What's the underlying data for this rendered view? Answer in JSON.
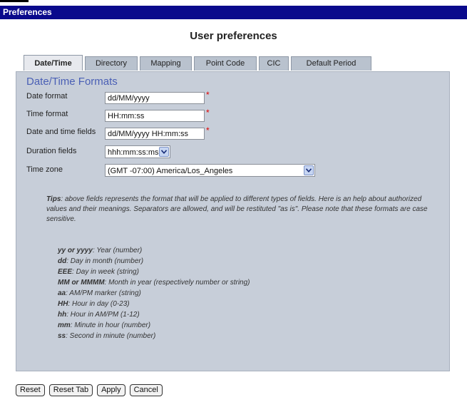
{
  "window": {
    "title": "Preferences"
  },
  "page": {
    "heading": "User preferences"
  },
  "tabs": [
    {
      "label": "Date/Time",
      "active": true
    },
    {
      "label": "Directory"
    },
    {
      "label": "Mapping"
    },
    {
      "label": "Point Code"
    },
    {
      "label": "CIC"
    },
    {
      "label": "Default Period"
    }
  ],
  "section": {
    "title": "Date/Time Formats"
  },
  "fields": {
    "date_format": {
      "label": "Date format",
      "value": "dd/MM/yyyy",
      "required": "*"
    },
    "time_format": {
      "label": "Time format",
      "value": "HH:mm:ss",
      "required": "*"
    },
    "datetime_fields": {
      "label": "Date and time fields",
      "value": "dd/MM/yyyy HH:mm:ss",
      "required": "*"
    },
    "duration_fields": {
      "label": "Duration fields",
      "value": "hhh:mm:ss:ms"
    },
    "time_zone": {
      "label": "Time zone",
      "value": "(GMT -07:00) America/Los_Angeles"
    }
  },
  "tips": {
    "lead": "Tips",
    "text": ": above fields represents the format that will be applied to different types of fields. Here is an help about authorized values and their meanings. Separators are allowed, and will be restituted \"as is\". Please note that these formats are case sensitive."
  },
  "legend": [
    {
      "key": "yy or yyyy",
      "desc": ": Year (number)"
    },
    {
      "key": "dd",
      "desc": ": Day in month (number)"
    },
    {
      "key": "EEE",
      "desc": ": Day in week (string)"
    },
    {
      "key": "MM or MMMM",
      "desc": ": Month in year (respectively number or string)"
    },
    {
      "key": "aa",
      "desc": ": AM/PM marker (string)"
    },
    {
      "key": "HH",
      "desc": ": Hour in day (0-23)"
    },
    {
      "key": "hh",
      "desc": ": Hour in AM/PM (1-12)"
    },
    {
      "key": "mm",
      "desc": ": Minute in hour (number)"
    },
    {
      "key": "ss",
      "desc": ": Second in minute (number)"
    }
  ],
  "buttons": {
    "reset": "Reset",
    "reset_tab": "Reset Tab",
    "apply": "Apply",
    "cancel": "Cancel"
  },
  "colors": {
    "titlebar": "#0a0a8c",
    "panel": "#c7ced9",
    "section_title": "#4a5fb5",
    "required": "#e00000"
  }
}
